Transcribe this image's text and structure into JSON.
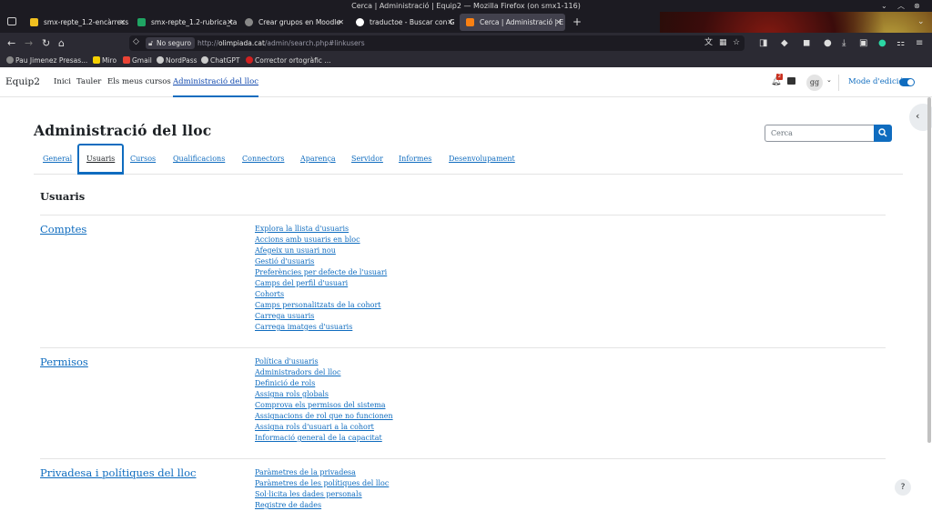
{
  "window": {
    "title": "Cerca | Administració | Equip2 — Mozilla Firefox (on smx1-116)",
    "controls": [
      "⌄",
      "︿",
      "⊗"
    ]
  },
  "tabs": [
    {
      "label": "smx-repte_1.2-encàrrecs",
      "icon_color": "#f0c020"
    },
    {
      "label": "smx-repte_1.2-rubrica_ta",
      "icon_color": "#1fa463"
    },
    {
      "label": "Crear grupos en Moodle",
      "icon_color": "#888888"
    },
    {
      "label": "traductoe - Buscar con G",
      "icon_color": "#ffffff"
    },
    {
      "label": "Cerca | Administració | E",
      "icon_color": "#f98012"
    }
  ],
  "navbar": {
    "security_label": "No seguro",
    "url_host": "olimpiada.cat",
    "url_path": "/admin/search.php#linkusers"
  },
  "bookmarks": [
    {
      "label": "Pau Jimenez Presas...",
      "icon_color": "#888888"
    },
    {
      "label": "Miro",
      "icon_color": "#f5d000"
    },
    {
      "label": "Gmail",
      "icon_color": "#ea4335"
    },
    {
      "label": "NordPass",
      "icon_color": "#cccccc"
    },
    {
      "label": "ChatGPT",
      "icon_color": "#cccccc"
    },
    {
      "label": "Corrector ortogràfic ...",
      "icon_color": "#d02020"
    }
  ],
  "site": {
    "brand": "Equip2",
    "nav": [
      "Inici",
      "Tauler",
      "Els meus cursos",
      "Administració del lloc"
    ],
    "notifications_count": "2",
    "avatar_initials": "gg",
    "edit_mode_label": "Mode d'edició"
  },
  "page": {
    "title": "Administració del lloc",
    "search_placeholder": "Cerca",
    "tabs": [
      "General",
      "Usuaris",
      "Cursos",
      "Qualificacions",
      "Connectors",
      "Aparença",
      "Servidor",
      "Informes",
      "Desenvolupament"
    ],
    "active_tab": "Usuaris",
    "section_title": "Usuaris"
  },
  "categories": [
    {
      "title": "Comptes",
      "links": [
        "Explora la llista d'usuaris",
        "Accions amb usuaris en bloc",
        "Afegeix un usuari nou",
        "Gestió d'usuaris",
        "Preferències per defecte de l'usuari",
        "Camps del perfil d'usuari",
        "Cohorts",
        "Camps personalitzats de la cohort",
        "Carrega usuaris",
        "Carrega imatges d'usuaris"
      ]
    },
    {
      "title": "Permisos",
      "links": [
        "Política d'usuaris",
        "Administradors del lloc",
        "Definició de rols",
        "Assigna rols globals",
        "Comprova els permisos del sistema",
        "Assignacions de rol que no funcionen",
        "Assigna rols d'usuari a la cohort",
        "Informació general de la capacitat"
      ]
    },
    {
      "title": "Privadesa i polítiques del lloc",
      "links": [
        "Paràmetres de la privadesa",
        "Paràmetres de les polítiques del lloc",
        "Sol·licita les dades personals",
        "Registre de dades"
      ]
    }
  ],
  "help_label": "?"
}
